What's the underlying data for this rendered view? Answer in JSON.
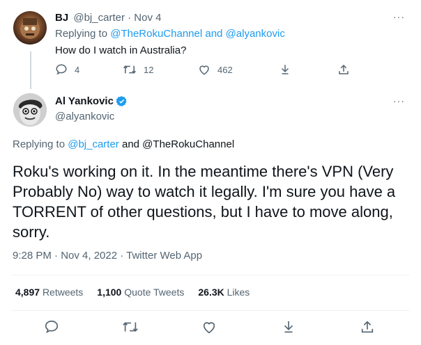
{
  "parent_tweet": {
    "name": "BJ",
    "handle_date": "@bj_carter · Nov 4",
    "replying_prefix": "Replying to",
    "replying_user1": "@TheRokuChannel",
    "replying_and": "and",
    "replying_user2": "@alyankovic",
    "text": "How do I watch in Australia?",
    "reply_count": "4",
    "retweet_count": "12",
    "like_count": "462"
  },
  "main_tweet": {
    "name": "Al Yankovic",
    "handle": "@alyankovic",
    "replying_prefix": "Replying to",
    "replying_user1": "@bj_carter",
    "replying_rest": "and @TheRokuChannel",
    "text": "Roku's working on it. In the meantime there's VPN (Very Probably No) way to watch it legally. I'm sure you have a TORRENT of other questions, but I have to move along, sorry.",
    "timestamp": "9:28 PM · Nov 4, 2022 · Twitter Web App",
    "stats": {
      "retweets_value": "4,897",
      "retweets_label": "Retweets",
      "quotes_value": "1,100",
      "quotes_label": "Quote Tweets",
      "likes_value": "26.3K",
      "likes_label": "Likes"
    }
  },
  "more_glyph": "···",
  "colors": {
    "accent": "#1d9bf0",
    "muted": "#536471",
    "text": "#0f1419",
    "divider": "#eff3f4"
  },
  "icons": [
    "reply-icon",
    "retweet-icon",
    "like-icon",
    "download-icon",
    "share-icon",
    "verified-icon",
    "more-icon"
  ]
}
